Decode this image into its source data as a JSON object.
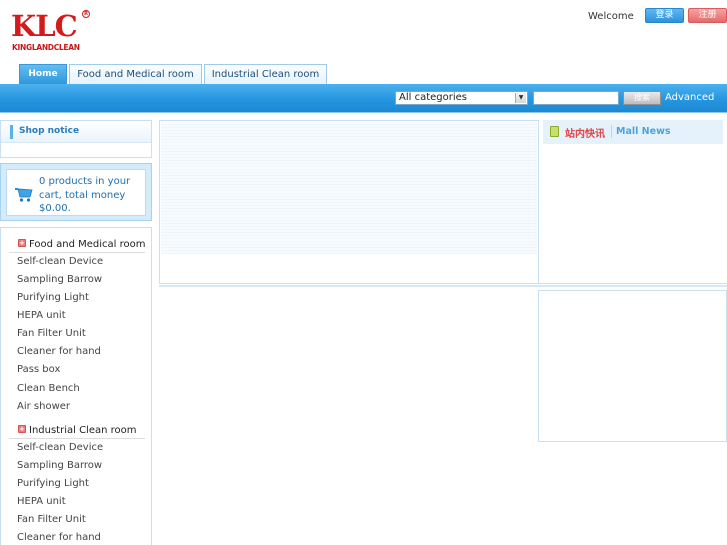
{
  "header": {
    "logo_text": "KLC",
    "logo_subtext": "KINGLANDCLEAN",
    "logo_reg": "R",
    "welcome": "Welcome",
    "login_label": "登录",
    "register_label": "注册"
  },
  "tabs": [
    {
      "label": "Home",
      "active": true
    },
    {
      "label": "Food and Medical room",
      "active": false
    },
    {
      "label": "Industrial Clean room",
      "active": false
    }
  ],
  "search": {
    "category_selected": "All categories",
    "button_label": "搜索",
    "advanced_label": "Advanced"
  },
  "shop_notice": {
    "title": "Shop notice"
  },
  "cart": {
    "text": "0 products in your cart, total money $0.00."
  },
  "categories": [
    {
      "name": "Food and Medical room",
      "items": [
        "Self-clean Device",
        "Sampling Barrow",
        "Purifying Light",
        "HEPA unit",
        "Fan Filter Unit",
        "Cleaner for hand",
        "Pass box",
        "Clean Bench",
        "Air shower"
      ]
    },
    {
      "name": "Industrial Clean room",
      "items": [
        "Self-clean Device",
        "Sampling Barrow",
        "Purifying Light",
        "HEPA unit",
        "Fan Filter Unit",
        "Cleaner for hand"
      ]
    }
  ],
  "mall_news": {
    "title_cn": "站内快讯",
    "title_en": "Mall News"
  },
  "icons": {
    "cart": "cart-icon",
    "category_toggle": "plus-icon",
    "news": "note-icon",
    "dropdown": "chevron-down-icon"
  },
  "colors": {
    "brand_red": "#d31b1b",
    "nav_blue": "#2696e0",
    "link_blue": "#1e6fb0",
    "news_red": "#e24545"
  }
}
